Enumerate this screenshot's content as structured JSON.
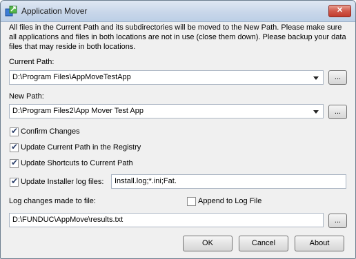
{
  "window": {
    "title": "Application Mover",
    "close_label": "✕"
  },
  "description": "All files in the Current Path and its subdirectories will be moved to the New Path.  Please make sure all applications and files in both locations are not in use (close them down).  Please backup your data files that may reside in both locations.",
  "current_path": {
    "label": "Current Path:",
    "value": "D:\\Program Files\\AppMoveTestApp",
    "browse_label": "..."
  },
  "new_path": {
    "label": "New Path:",
    "value": "D:\\Program Files2\\App Mover Test App",
    "browse_label": "..."
  },
  "options": {
    "confirm_changes": {
      "label": "Confirm Changes",
      "checked": true
    },
    "update_registry": {
      "label": "Update Current Path in the Registry",
      "checked": true
    },
    "update_shortcuts": {
      "label": "Update Shortcuts to Current Path",
      "checked": true
    },
    "update_installer_logs": {
      "label": "Update Installer log files:",
      "checked": true,
      "value": "Install.log;*.ini;Fat."
    }
  },
  "log": {
    "label": "Log changes made to file:",
    "append_label": "Append to Log File",
    "append_checked": false,
    "value": "D:\\FUNDUC\\AppMove\\results.txt",
    "browse_label": "..."
  },
  "buttons": {
    "ok": "OK",
    "cancel": "Cancel",
    "about": "About"
  },
  "colors": {
    "titlebar": "#c9d7ea",
    "close": "#c23b2d",
    "face": "#f0f0f0"
  }
}
